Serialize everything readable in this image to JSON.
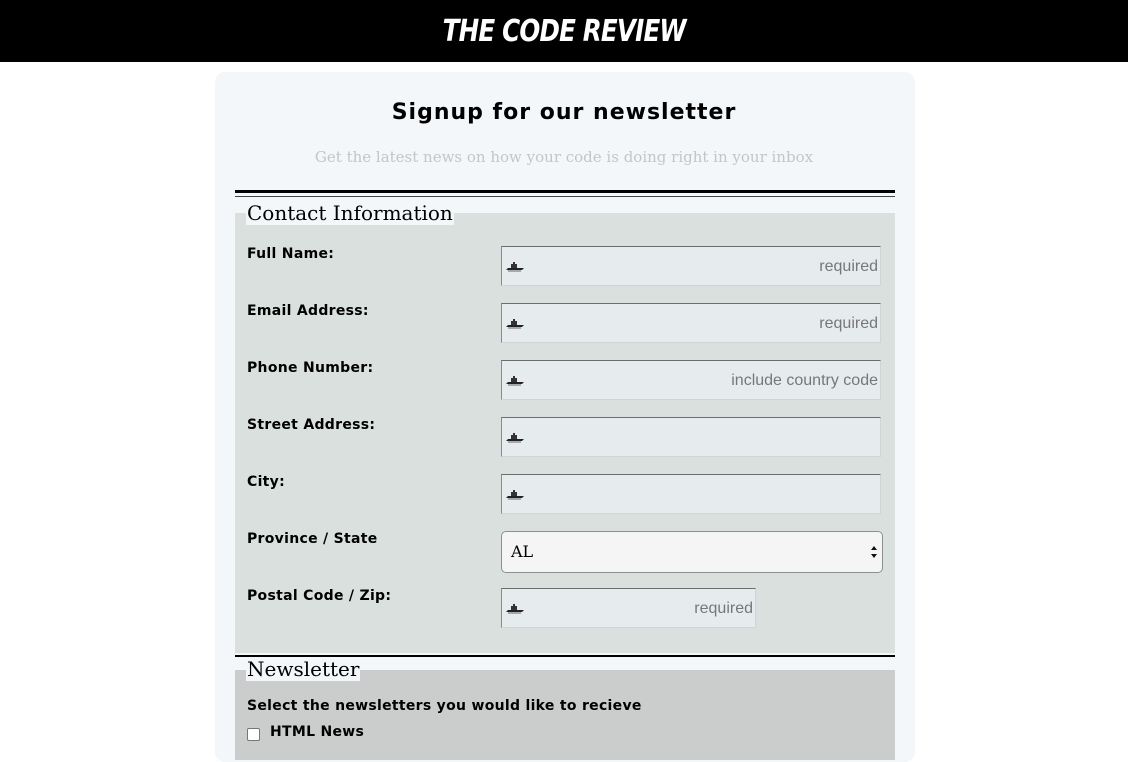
{
  "header": {
    "site_title": "THE CODE REVIEW"
  },
  "form": {
    "title": "Signup for our newsletter",
    "subtitle": "Get the latest news on how your code is doing right in your inbox",
    "contact": {
      "legend": "Contact Information",
      "fields": [
        {
          "label": "Full Name:",
          "placeholder": "required",
          "icon": "input-autofill-icon"
        },
        {
          "label": "Email Address:",
          "placeholder": "required",
          "icon": "input-autofill-icon"
        },
        {
          "label": "Phone Number:",
          "placeholder": "include country code",
          "icon": "input-autofill-icon"
        },
        {
          "label": "Street Address:",
          "placeholder": "",
          "icon": "input-autofill-icon"
        },
        {
          "label": "City:",
          "placeholder": "",
          "icon": "input-autofill-icon"
        }
      ],
      "province": {
        "label": "Province / State",
        "selected": "AL"
      },
      "postal": {
        "label": "Postal Code / Zip:",
        "placeholder": "required",
        "icon": "input-autofill-icon"
      }
    },
    "newsletter": {
      "legend": "Newsletter",
      "prompt": "Select the newsletters you would like to recieve",
      "options": [
        {
          "label": "HTML News",
          "checked": false
        }
      ]
    }
  },
  "colors": {
    "header_bg": "#000000",
    "card_bg": "#f3f7fa",
    "contact_bg": "#d9e0de",
    "newsletter_bg": "#cacdcc",
    "input_bg": "#e6eced",
    "subtitle_text": "#c2c6c9"
  }
}
